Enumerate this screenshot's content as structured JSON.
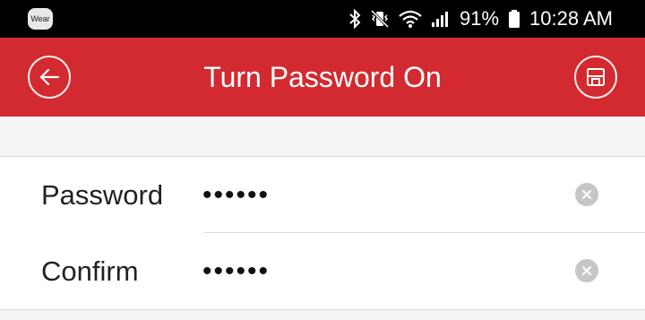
{
  "status_bar": {
    "wear_label": "Wear",
    "battery": "91%",
    "time": "10:28 AM",
    "icons": [
      "bluetooth-icon",
      "vibrate-mute-icon",
      "wifi-icon",
      "signal-icon",
      "battery-icon"
    ]
  },
  "app_bar": {
    "title": "Turn Password On",
    "back_icon": "back-arrow-icon",
    "save_icon": "save-disk-icon",
    "color": "#d22a30"
  },
  "form": {
    "fields": [
      {
        "label": "Password",
        "value": "••••••"
      },
      {
        "label": "Confirm",
        "value": "••••••"
      }
    ],
    "clear_icon": "clear-icon"
  }
}
